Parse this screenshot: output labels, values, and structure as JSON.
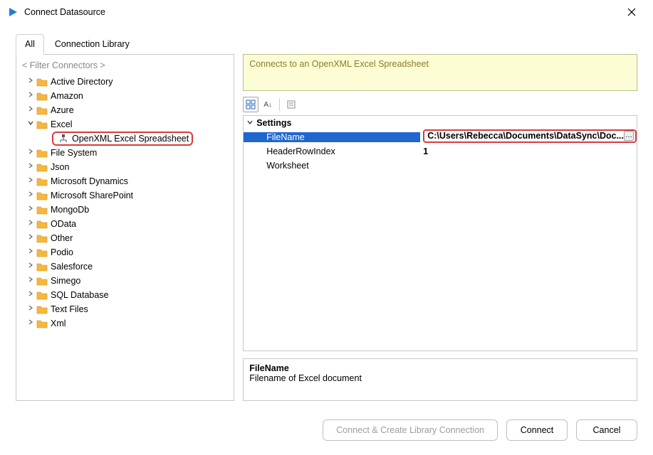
{
  "window": {
    "title": "Connect Datasource"
  },
  "tabs": {
    "all": "All",
    "library": "Connection Library"
  },
  "filter_placeholder": "< Filter Connectors >",
  "tree": [
    {
      "label": "Active Directory",
      "expanded": false
    },
    {
      "label": "Amazon",
      "expanded": false
    },
    {
      "label": "Azure",
      "expanded": false
    },
    {
      "label": "Excel",
      "expanded": true,
      "children": [
        {
          "label": "OpenXML Excel Spreadsheet",
          "highlighted": true
        }
      ]
    },
    {
      "label": "File System",
      "expanded": false
    },
    {
      "label": "Json",
      "expanded": false
    },
    {
      "label": "Microsoft Dynamics",
      "expanded": false
    },
    {
      "label": "Microsoft SharePoint",
      "expanded": false
    },
    {
      "label": "MongoDb",
      "expanded": false
    },
    {
      "label": "OData",
      "expanded": false
    },
    {
      "label": "Other",
      "expanded": false
    },
    {
      "label": "Podio",
      "expanded": false
    },
    {
      "label": "Salesforce",
      "expanded": false
    },
    {
      "label": "Simego",
      "expanded": false
    },
    {
      "label": "SQL Database",
      "expanded": false
    },
    {
      "label": "Text Files",
      "expanded": false
    },
    {
      "label": "Xml",
      "expanded": false
    }
  ],
  "banner": "Connects to an OpenXML Excel Spreadsheet",
  "settings_group": "Settings",
  "settings": {
    "FileName": {
      "label": "FileName",
      "value": "C:\\Users\\Rebecca\\Documents\\DataSync\\Doc..."
    },
    "HeaderRowIndex": {
      "label": "HeaderRowIndex",
      "value": "1"
    },
    "Worksheet": {
      "label": "Worksheet",
      "value": ""
    }
  },
  "description": {
    "title": "FileName",
    "body": "Filename of Excel document"
  },
  "buttons": {
    "create_lib": "Connect & Create Library Connection",
    "connect": "Connect",
    "cancel": "Cancel"
  }
}
